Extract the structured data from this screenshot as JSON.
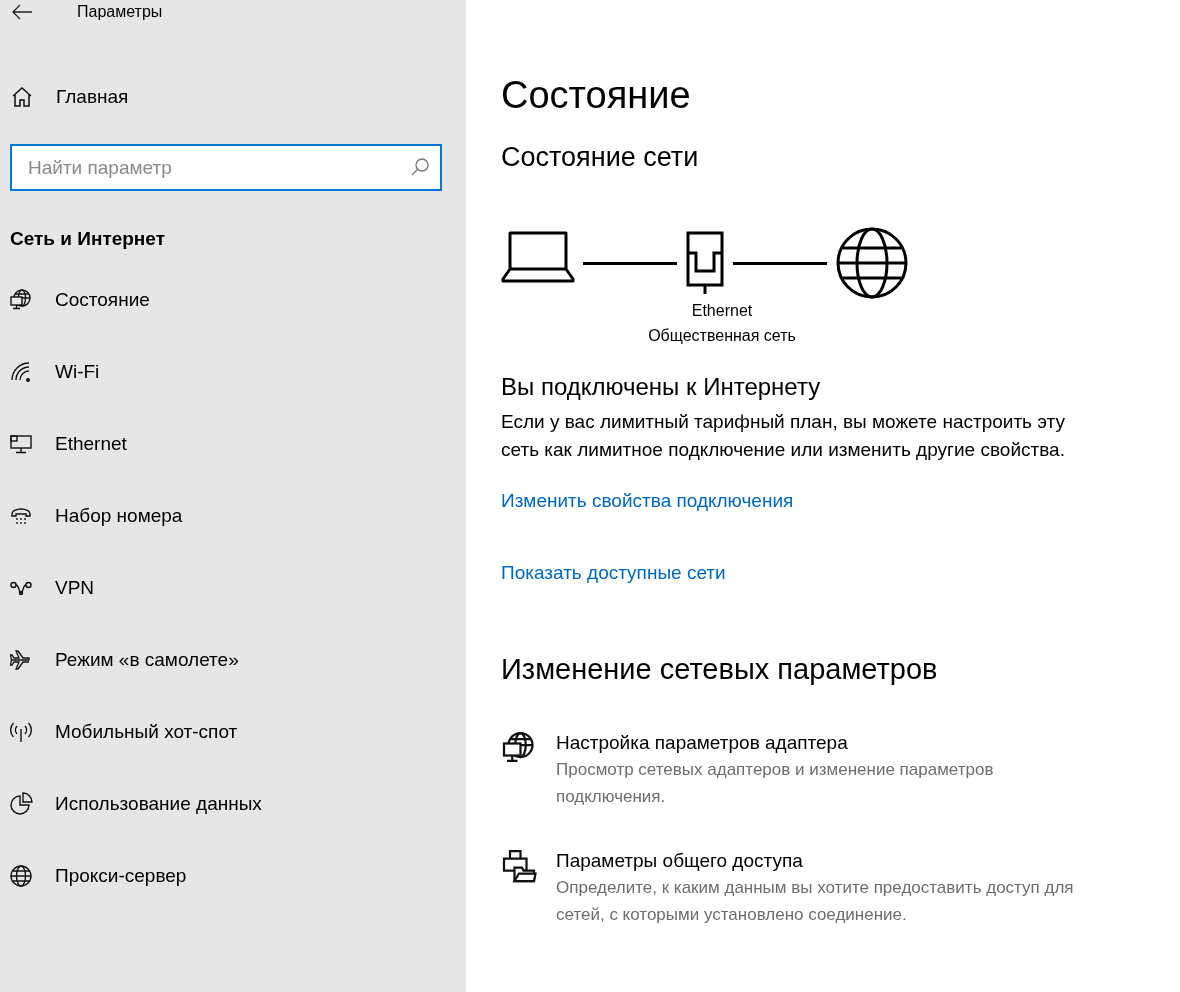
{
  "window": {
    "title": "Параметры"
  },
  "sidebar": {
    "home": "Главная",
    "search": {
      "placeholder": "Найти параметр"
    },
    "section": "Сеть и Интернет",
    "items": [
      {
        "label": "Состояние",
        "kind": "status",
        "selected": false
      },
      {
        "label": "Wi-Fi",
        "kind": "wifi",
        "selected": false
      },
      {
        "label": "Ethernet",
        "kind": "ethernet",
        "selected": false
      },
      {
        "label": "Набор номера",
        "kind": "dialup",
        "selected": false
      },
      {
        "label": "VPN",
        "kind": "vpn",
        "selected": false
      },
      {
        "label": "Режим «в самолете»",
        "kind": "airplane",
        "selected": false
      },
      {
        "label": "Мобильный хот-спот",
        "kind": "hotspot",
        "selected": false
      },
      {
        "label": "Использование данных",
        "kind": "data",
        "selected": false
      },
      {
        "label": "Прокси-сервер",
        "kind": "proxy",
        "selected": false
      }
    ]
  },
  "main": {
    "title": "Состояние",
    "network_status": {
      "heading": "Состояние сети",
      "adapter": "Ethernet",
      "network_type": "Общественная сеть"
    },
    "connected": {
      "heading": "Вы подключены к Интернету",
      "text": "Если у вас лимитный тарифный план, вы можете настроить эту сеть как лимитное подключение или изменить другие свойства.",
      "links": [
        "Изменить свойства подключения",
        "Показать доступные сети"
      ]
    },
    "change": {
      "heading": "Изменение сетевых параметров",
      "items": [
        {
          "kind": "adapter",
          "title": "Настройка параметров адаптера",
          "description": "Просмотр сетевых адаптеров и изменение параметров подключения."
        },
        {
          "kind": "sharing",
          "title": "Параметры общего доступа",
          "description": "Определите, к каким данным вы хотите предоставить доступ для сетей, с которыми установлено соединение."
        }
      ]
    }
  }
}
